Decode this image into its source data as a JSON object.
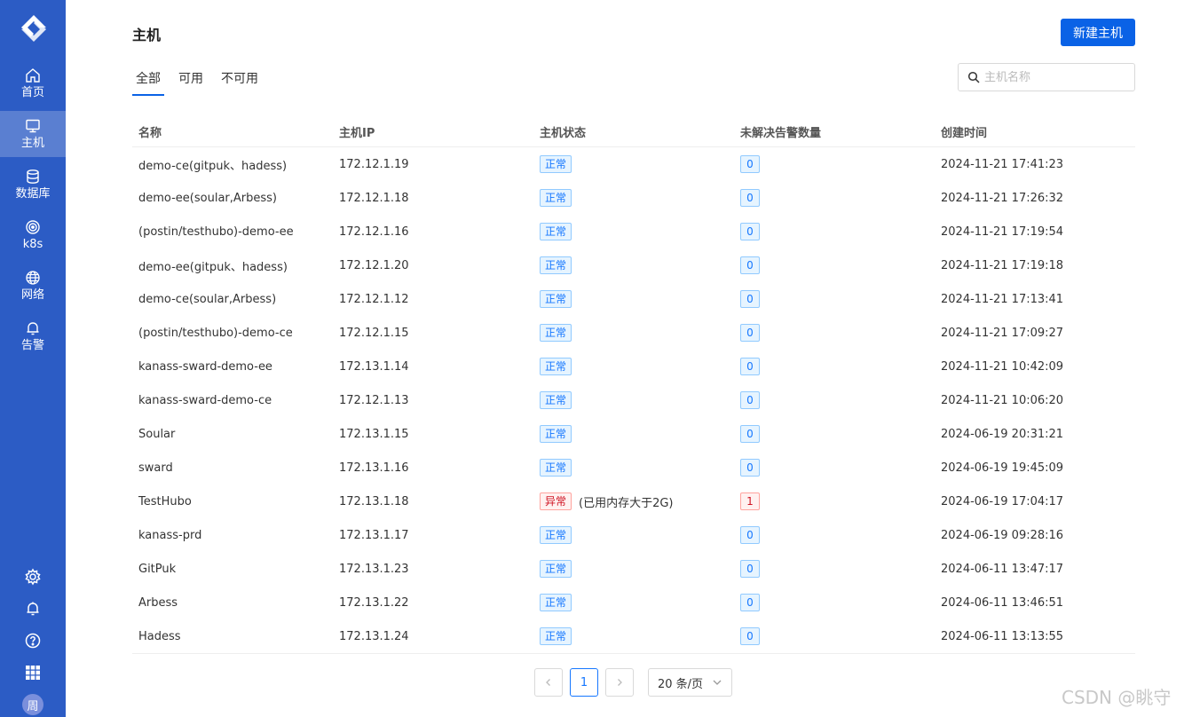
{
  "sidebar": {
    "colors": {
      "background": "#2c5cc5",
      "active": "#4d78d1"
    },
    "items": [
      {
        "label": "首页",
        "icon": "home-icon"
      },
      {
        "label": "主机",
        "icon": "monitor-icon",
        "active": true
      },
      {
        "label": "数据库",
        "icon": "database-icon"
      },
      {
        "label": "k8s",
        "icon": "kubernetes-icon"
      },
      {
        "label": "网络",
        "icon": "globe-icon"
      },
      {
        "label": "告警",
        "icon": "bell-icon"
      }
    ],
    "bottom": [
      "gear-icon",
      "notification-icon",
      "help-icon",
      "apps-grid-icon"
    ],
    "avatar": "周"
  },
  "header": {
    "title": "主机",
    "new_button": "新建主机"
  },
  "tabs": [
    {
      "label": "全部",
      "active": true
    },
    {
      "label": "可用"
    },
    {
      "label": "不可用"
    }
  ],
  "search": {
    "placeholder": "主机名称"
  },
  "table": {
    "columns": [
      "名称",
      "主机IP",
      "主机状态",
      "未解决告警数量",
      "创建时间"
    ],
    "rows": [
      {
        "name": "demo-ce(gitpuk、hadess)",
        "ip": "172.12.1.19",
        "status": "正常",
        "alerts": "0",
        "created": "2024-11-21 17:41:23"
      },
      {
        "name": "demo-ee(soular,Arbess)",
        "ip": "172.12.1.18",
        "status": "正常",
        "alerts": "0",
        "created": "2024-11-21 17:26:32"
      },
      {
        "name": "(postin/testhubo)-demo-ee",
        "ip": "172.12.1.16",
        "status": "正常",
        "alerts": "0",
        "created": "2024-11-21 17:19:54"
      },
      {
        "name": "demo-ee(gitpuk、hadess)",
        "ip": "172.12.1.20",
        "status": "正常",
        "alerts": "0",
        "created": "2024-11-21 17:19:18"
      },
      {
        "name": "demo-ce(soular,Arbess)",
        "ip": "172.12.1.12",
        "status": "正常",
        "alerts": "0",
        "created": "2024-11-21 17:13:41"
      },
      {
        "name": "(postin/testhubo)-demo-ce",
        "ip": "172.12.1.15",
        "status": "正常",
        "alerts": "0",
        "created": "2024-11-21 17:09:27"
      },
      {
        "name": "kanass-sward-demo-ee",
        "ip": "172.13.1.14",
        "status": "正常",
        "alerts": "0",
        "created": "2024-11-21 10:42:09"
      },
      {
        "name": "kanass-sward-demo-ce",
        "ip": "172.12.1.13",
        "status": "正常",
        "alerts": "0",
        "created": "2024-11-21 10:06:20"
      },
      {
        "name": "Soular",
        "ip": "172.13.1.15",
        "status": "正常",
        "alerts": "0",
        "created": "2024-06-19 20:31:21"
      },
      {
        "name": "sward",
        "ip": "172.13.1.16",
        "status": "正常",
        "alerts": "0",
        "created": "2024-06-19 19:45:09"
      },
      {
        "name": "TestHubo",
        "ip": "172.13.1.18",
        "status": "异常",
        "status_note": "(已用内存大于2G)",
        "alerts": "1",
        "error": true,
        "created": "2024-06-19 17:04:17"
      },
      {
        "name": "kanass-prd",
        "ip": "172.13.1.17",
        "status": "正常",
        "alerts": "0",
        "created": "2024-06-19 09:28:16"
      },
      {
        "name": "GitPuk",
        "ip": "172.13.1.23",
        "status": "正常",
        "alerts": "0",
        "created": "2024-06-11 13:47:17"
      },
      {
        "name": "Arbess",
        "ip": "172.13.1.22",
        "status": "正常",
        "alerts": "0",
        "created": "2024-06-11 13:46:51"
      },
      {
        "name": "Hadess",
        "ip": "172.13.1.24",
        "status": "正常",
        "alerts": "0",
        "created": "2024-06-11 13:13:55"
      }
    ]
  },
  "pagination": {
    "current": "1",
    "page_size": "20 条/页"
  },
  "watermark": "CSDN @眺守"
}
